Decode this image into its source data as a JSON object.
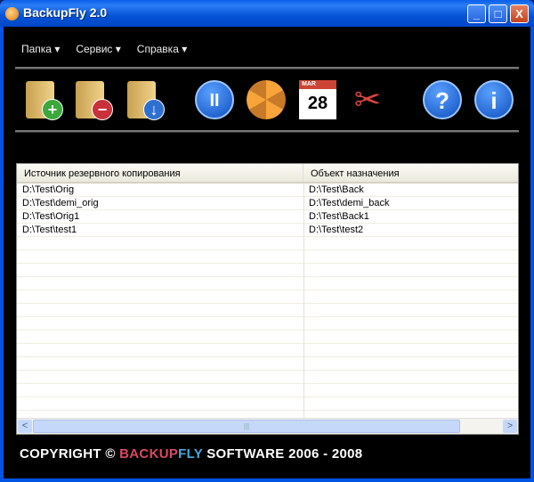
{
  "window": {
    "title": "BackupFly 2.0",
    "min": "_",
    "max": "□",
    "close": "X"
  },
  "menu": [
    "Папка",
    "Сервис",
    "Справка"
  ],
  "toolbar": {
    "add": "+",
    "remove": "−",
    "restore": "↓",
    "pause": "II",
    "calendar_month": "MAR",
    "calendar_day": "28",
    "help": "?",
    "info": "i"
  },
  "table": {
    "columns": [
      "Источник резервного копирования",
      "Объект назначения"
    ],
    "rows": [
      [
        "D:\\Test\\Orig",
        "D:\\Test\\Back"
      ],
      [
        "D:\\Test\\demi_orig",
        "D:\\Test\\demi_back"
      ],
      [
        "D:\\Test\\Orig1",
        "D:\\Test\\Back1"
      ],
      [
        "D:\\Test\\test1",
        "D:\\Test\\test2"
      ]
    ]
  },
  "scroll": {
    "left": "<",
    "right": ">",
    "grip": "|||"
  },
  "footer": {
    "pre": "COPYRIGHT © ",
    "backup": "BACKUP",
    "fly": "FLY",
    "post": " SOFTWARE 2006 - 2008"
  },
  "colors": {
    "backup": "#d94a63",
    "fly": "#4aa8e0"
  }
}
